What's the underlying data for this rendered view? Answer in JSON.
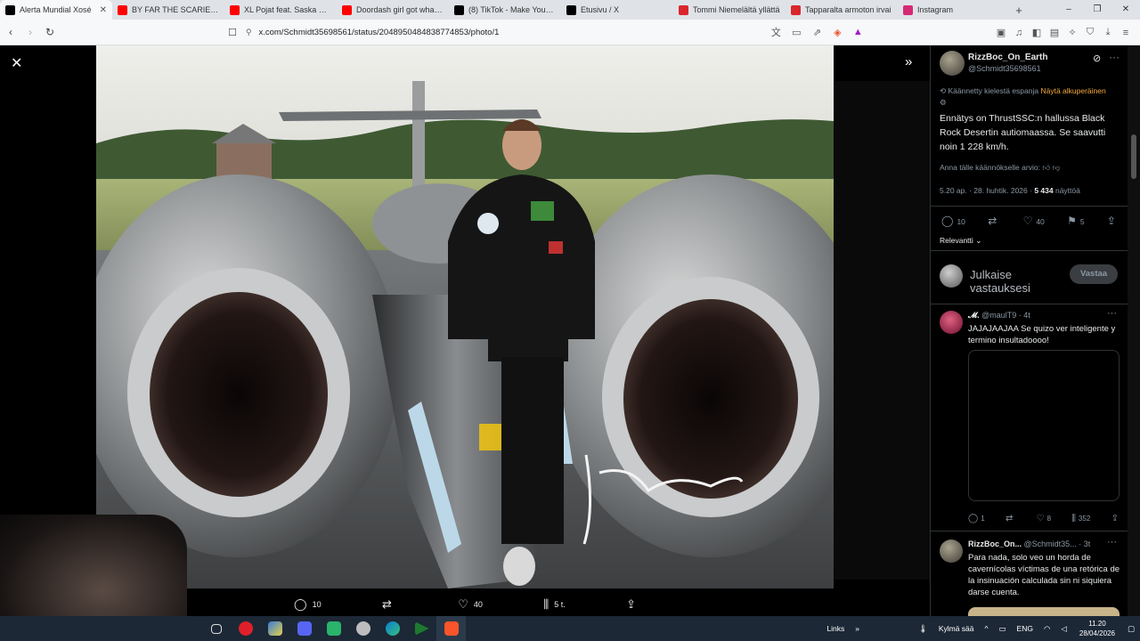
{
  "browser": {
    "tabs": [
      {
        "label": "Alerta Mundial Xosé",
        "favicon": "x-icon",
        "color": "#000000",
        "active": true
      },
      {
        "label": "BY FAR THE SCARIEST GAME",
        "favicon": "youtube-icon",
        "color": "#ff0000"
      },
      {
        "label": "XL Pojat feat. Saska Nyman",
        "favicon": "youtube-icon",
        "color": "#ff0000"
      },
      {
        "label": "Doordash girl got what she",
        "favicon": "youtube-icon",
        "color": "#ff0000"
      },
      {
        "label": "(8) TikTok - Make Your Day",
        "favicon": "tiktok-icon",
        "color": "#000000"
      },
      {
        "label": "Etusivu / X",
        "favicon": "x-icon",
        "color": "#000000"
      },
      {
        "label": "Tommi Niemelältä yllättä",
        "favicon": "iltalehti-icon",
        "color": "#d9262c"
      },
      {
        "label": "Tapparalta armoton irvai",
        "favicon": "iltalehti-icon",
        "color": "#d9262c"
      },
      {
        "label": "Instagram",
        "favicon": "instagram-icon",
        "color": "#d62976"
      }
    ],
    "new_tab": "+",
    "window_controls": [
      "–",
      "❐",
      "✕"
    ],
    "url": "x.com/Schmidt35698561/status/2048950484838774853/photo/1"
  },
  "viewer": {
    "actions": [
      {
        "name": "reply",
        "icon": "comment-icon",
        "glyph": "◯",
        "count": "10"
      },
      {
        "name": "repost",
        "icon": "repost-icon",
        "glyph": "⇄",
        "count": ""
      },
      {
        "name": "like",
        "icon": "heart-icon",
        "glyph": "♡",
        "count": "40"
      },
      {
        "name": "views",
        "icon": "views-icon",
        "glyph": "⫼",
        "count": "5 t."
      },
      {
        "name": "share",
        "icon": "share-icon",
        "glyph": "⇪",
        "count": ""
      }
    ]
  },
  "post": {
    "author_name": "RizzBoc_On_Earth",
    "author_handle": "@Schmidt35698561",
    "translated_note": "Käännetty kielestä espanja",
    "show_original": "Näytä alkuperäinen",
    "text": "Ennätys on ThrustSSC:n hallussa Black Rock Desertin autiomaassa. Se saavutti noin 1 228 km/h.",
    "rate_translation": "Anna tälle käännökselle arvio:",
    "time": "5.20 ap. · 28. huhtik. 2026 · ",
    "views": "5 434",
    "views_label": " näyttöä",
    "stats": {
      "replies": "10",
      "reposts": "",
      "likes": "40",
      "bookmarks": "5"
    },
    "sort_label": "Relevantti",
    "reply_placeholder": "Julkaise vastauksesi",
    "reply_button": "Vastaa"
  },
  "replies": [
    {
      "name": "𝓜.",
      "handle": "@maulT9 · 4t",
      "text": "JAJAJAAJAA Se quizo ver inteligente y termino insultadoooo!",
      "stats": {
        "replies": "1",
        "reposts": "",
        "likes": "8",
        "views": "352"
      }
    },
    {
      "name": "RizzBoc_On...",
      "handle": "@Schmidt35... · 3t",
      "text": "Para nada, solo veo un horda de cavernícolas víctimas de una retórica de la insinuación calculada sin ni siquiera darse cuenta."
    }
  ],
  "taskbar": {
    "links": "Links",
    "weather": "Kylmä sää",
    "lang": "ENG",
    "time": "11.20",
    "date": "28/04/2026"
  },
  "colors": {
    "accent": "#1d9bf0",
    "translate_orange": "#f4a93b",
    "panel_bg": "#000000"
  }
}
